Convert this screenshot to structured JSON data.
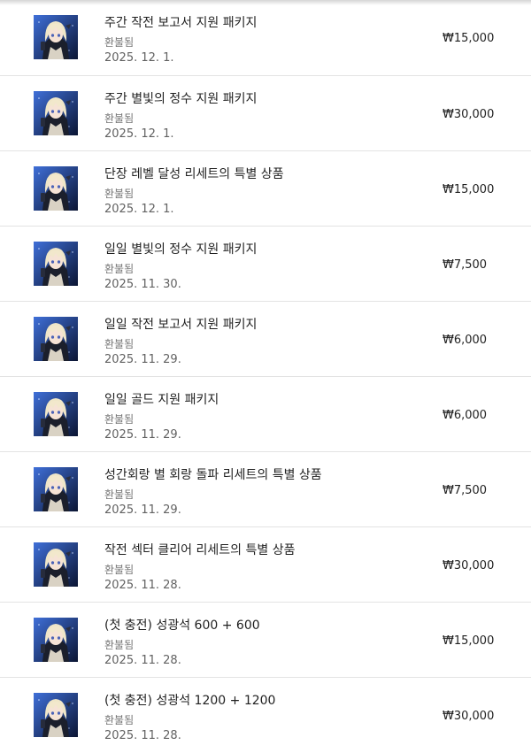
{
  "purchases": [
    {
      "title": "주간 작전 보고서 지원 패키지",
      "status": "환불됨",
      "date": "2025. 12. 1.",
      "price": "₩15,000",
      "icon": "game-character-icon"
    },
    {
      "title": "주간 별빛의 정수 지원 패키지",
      "status": "환불됨",
      "date": "2025. 12. 1.",
      "price": "₩30,000",
      "icon": "game-character-icon"
    },
    {
      "title": "단장 레벨 달성 리세트의 특별 상품",
      "status": "환불됨",
      "date": "2025. 12. 1.",
      "price": "₩15,000",
      "icon": "game-character-icon"
    },
    {
      "title": "일일 별빛의 정수 지원 패키지",
      "status": "환불됨",
      "date": "2025. 11. 30.",
      "price": "₩7,500",
      "icon": "game-character-icon"
    },
    {
      "title": "일일 작전 보고서 지원 패키지",
      "status": "환불됨",
      "date": "2025. 11. 29.",
      "price": "₩6,000",
      "icon": "game-character-icon"
    },
    {
      "title": "일일 골드 지원 패키지",
      "status": "환불됨",
      "date": "2025. 11. 29.",
      "price": "₩6,000",
      "icon": "game-character-icon"
    },
    {
      "title": "성간회랑 별 회랑 돌파 리세트의 특별 상품",
      "status": "환불됨",
      "date": "2025. 11. 29.",
      "price": "₩7,500",
      "icon": "game-character-icon"
    },
    {
      "title": "작전 섹터 클리어 리세트의 특별 상품",
      "status": "환불됨",
      "date": "2025. 11. 28.",
      "price": "₩30,000",
      "icon": "game-character-icon"
    },
    {
      "title": "(첫 충전) 성광석 600 + 600",
      "status": "환불됨",
      "date": "2025. 11. 28.",
      "price": "₩15,000",
      "icon": "game-character-icon"
    },
    {
      "title": "(첫 충전) 성광석 1200 + 1200",
      "status": "환불됨",
      "date": "2025. 11. 28.",
      "price": "₩30,000",
      "icon": "game-character-icon"
    }
  ]
}
